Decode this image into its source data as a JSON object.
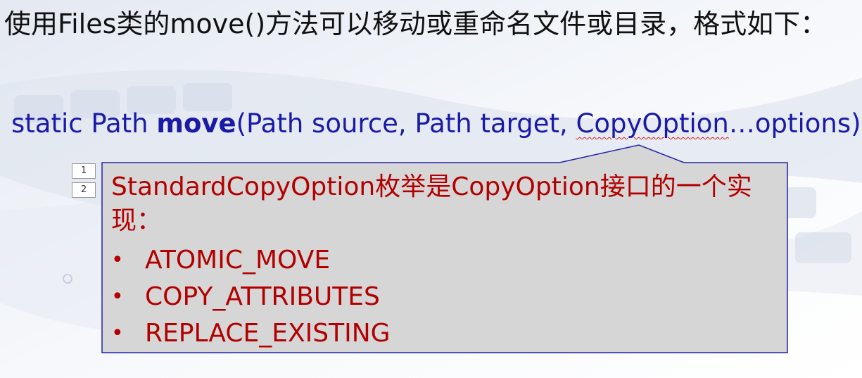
{
  "heading": "使用Files类的move()方法可以移动或重命名文件或目录，格式如下：",
  "signature": {
    "prefix": "static Path ",
    "method": "move",
    "params_before": "(Path source, Path target, ",
    "type_name": "CopyOption",
    "params_after": "…options)"
  },
  "callout": {
    "title": "StandardCopyOption枚举是CopyOption接口的一个实现：",
    "items": [
      "ATOMIC_MOVE",
      "COPY_ATTRIBUTES",
      "REPLACE_EXISTING"
    ],
    "bullet": "•"
  },
  "markers": [
    "1",
    "2"
  ],
  "colors": {
    "signature": "#1a1aa6",
    "callout_text": "#b20000",
    "callout_fill": "#d6d6d6",
    "callout_border": "#2222aa"
  }
}
